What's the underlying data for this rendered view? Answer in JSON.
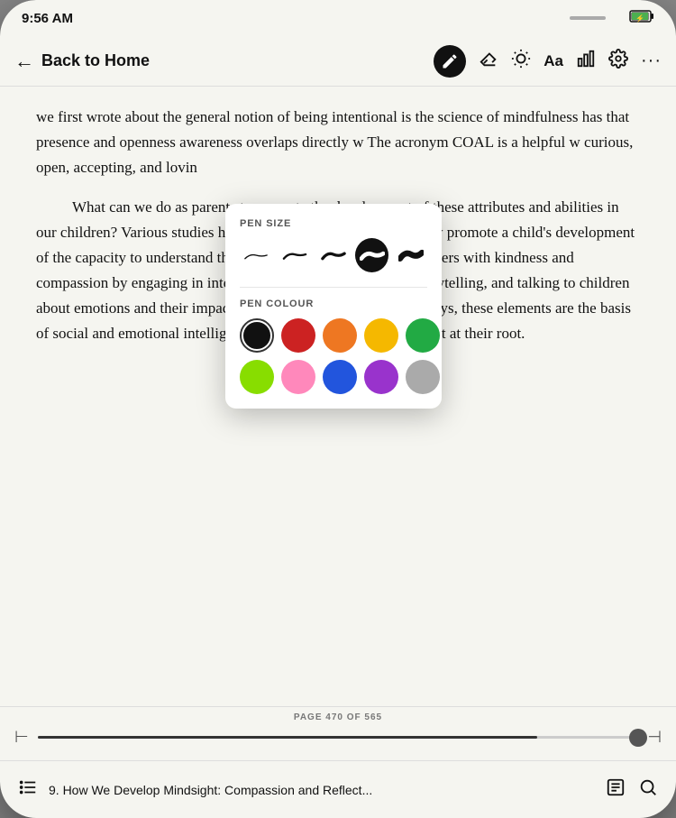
{
  "status_bar": {
    "time": "9:56 AM",
    "battery_icon": "🔋"
  },
  "toolbar": {
    "back_label": "Back to Home",
    "back_arrow": "←",
    "icons": {
      "pen": "pen",
      "eraser": "◇",
      "brightness": "☀",
      "font": "Aa",
      "chart": "📊",
      "settings": "⚙",
      "more": "···"
    }
  },
  "content": {
    "paragraphs": [
      "we first wrote about the general notion of being intentional is the science of mindfulness has that presence and openness awareness overlaps directly w The acronym COAL is a helpful w curious, open, accepting, and lovin",
      "What can we do as parents to promote the development of these attributes and abilities in our children? Various studies have shown that parents can actively promote a child's development of the capacity to understand the inner lives of themselves and others with kindness and compassion by engaging in interactions such as pretend play, storytelling, and talking to children about emotions and their impact on how they behave. In many ways, these elements are the basis of social and emotional intelligence, processes that have mindsight at their root."
    ]
  },
  "pen_popup": {
    "size_label": "PEN SIZE",
    "colour_label": "PEN COLOUR",
    "sizes": [
      {
        "id": "xs",
        "selected": false
      },
      {
        "id": "sm",
        "selected": false
      },
      {
        "id": "md",
        "selected": false
      },
      {
        "id": "lg",
        "selected": true
      },
      {
        "id": "xl",
        "selected": false
      }
    ],
    "colours": [
      {
        "name": "black",
        "hex": "#111111",
        "selected": true
      },
      {
        "name": "red",
        "hex": "#cc2222",
        "selected": false
      },
      {
        "name": "orange",
        "hex": "#ee7722",
        "selected": false
      },
      {
        "name": "yellow",
        "hex": "#f5b800",
        "selected": false
      },
      {
        "name": "green",
        "hex": "#22aa44",
        "selected": false
      },
      {
        "name": "lime",
        "hex": "#88dd00",
        "selected": false
      },
      {
        "name": "pink",
        "hex": "#ff88bb",
        "selected": false
      },
      {
        "name": "blue",
        "hex": "#2255dd",
        "selected": false
      },
      {
        "name": "purple",
        "hex": "#9933cc",
        "selected": false
      },
      {
        "name": "gray",
        "hex": "#aaaaaa",
        "selected": false
      }
    ]
  },
  "pagination": {
    "label": "PAGE 470 OF 565",
    "current_page": 470,
    "total_pages": 565,
    "progress_percent": 83.2
  },
  "bottom_nav": {
    "chapter_title": "9. How We Develop Mindsight: Compassion and Reflect...",
    "list_icon": "☰",
    "page_icon": "📄",
    "search_icon": "🔍"
  }
}
